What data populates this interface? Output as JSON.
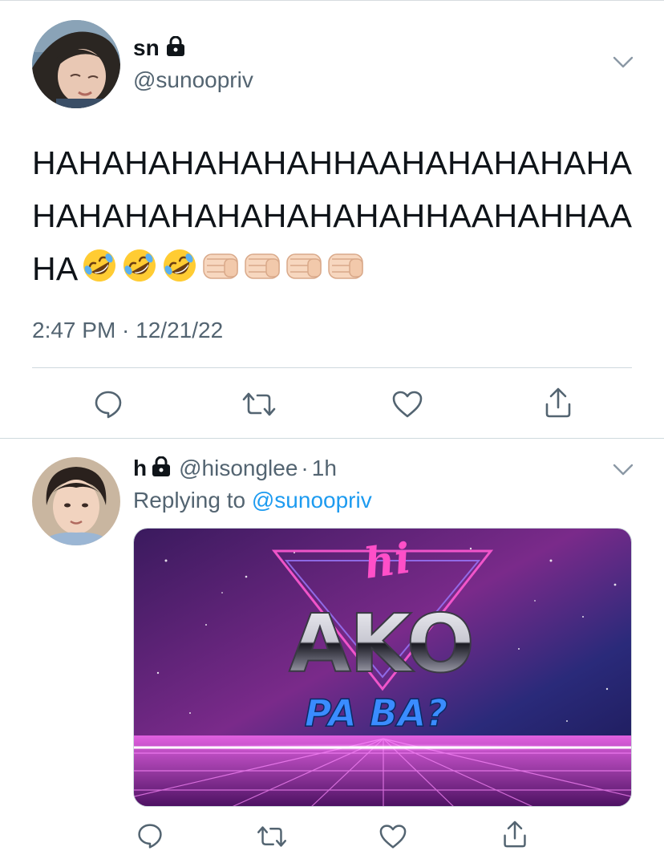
{
  "tweet": {
    "author": {
      "display_name": "sn",
      "handle": "@sunoopriv",
      "protected": true
    },
    "text_lines": [
      "HAHAHAHAHAHAHHAAHAHAHAHAHA",
      "HAHAHAHAHAHAHAHAHHAAHAHHAA",
      "HA"
    ],
    "emojis": [
      "rolling-on-floor-laughing",
      "rolling-on-floor-laughing",
      "rolling-on-floor-laughing",
      "fist",
      "fist",
      "fist",
      "fist"
    ],
    "timestamp": "2:47 PM · 12/21/22",
    "actions": [
      "reply",
      "retweet",
      "like",
      "share"
    ]
  },
  "reply": {
    "author": {
      "display_name": "h",
      "handle": "@hisonglee",
      "protected": true
    },
    "meta_separator": "·",
    "age": "1h",
    "replying_to_label": "Replying to",
    "replying_to_handle": "@sunoopriv",
    "media": {
      "script_text": "hi",
      "main_text": "AKO",
      "sub_text": "PA BA?"
    },
    "actions": [
      "reply",
      "retweet",
      "like",
      "share"
    ]
  },
  "colors": {
    "text_primary": "#0f1419",
    "text_secondary": "#536471",
    "link": "#1d9bf0",
    "divider": "#cfd9de"
  }
}
